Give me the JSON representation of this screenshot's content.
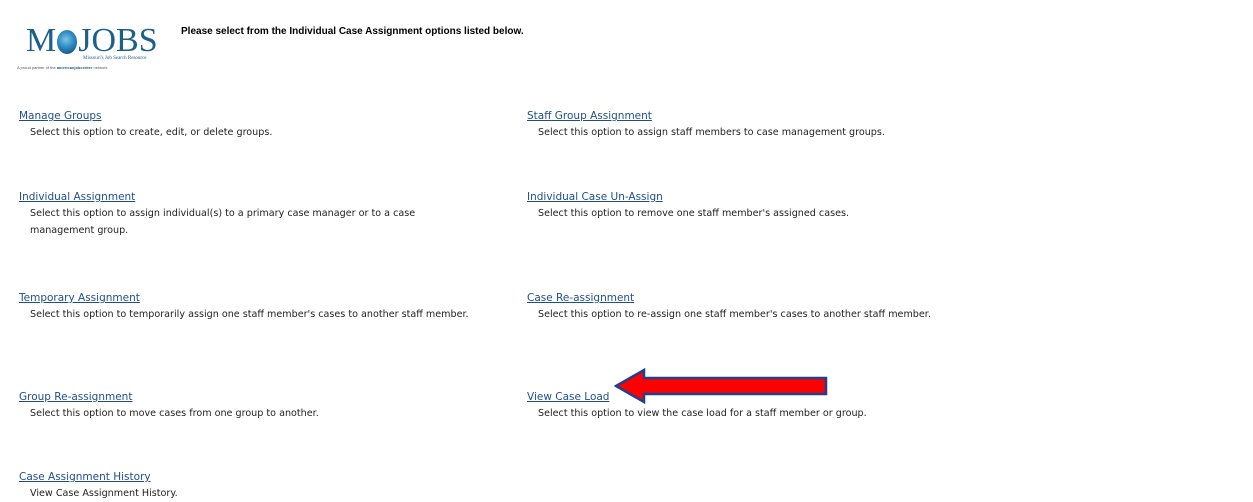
{
  "logo": {
    "name": "MoJOBS",
    "tagline": "Missouri's Job Search Resource",
    "partner_prefix": "A proud partner of the ",
    "partner_brand": "americanjobcenter",
    "partner_suffix": " network"
  },
  "heading": "Please select from the Individual Case Assignment options listed below.",
  "options": [
    {
      "label": "Manage Groups",
      "description": "Select this option to create, edit, or delete groups."
    },
    {
      "label": "Staff Group Assignment",
      "description": "Select this option to assign staff members to case management groups."
    },
    {
      "label": "Individual Assignment",
      "description": "Select this option to assign individual(s) to a primary case manager or to a case management group."
    },
    {
      "label": "Individual Case Un-Assign",
      "description": "Select this option to remove one staff member's assigned cases."
    },
    {
      "label": "Temporary Assignment",
      "description": "Select this option to temporarily assign one staff member's cases to another staff member."
    },
    {
      "label": "Case Re-assignment",
      "description": "Select this option to re-assign one staff member's cases to another staff member."
    },
    {
      "label": "Group Re-assignment",
      "description": "Select this option to move cases from one group to another."
    },
    {
      "label": "View Case Load",
      "description": "Select this option to view the case load for a staff member or group."
    },
    {
      "label": "Case Assignment History",
      "description": "View Case Assignment History."
    }
  ],
  "colors": {
    "link": "#1f4e8c",
    "arrow_fill": "#ff0000",
    "arrow_outline": "#1f3f8f"
  }
}
